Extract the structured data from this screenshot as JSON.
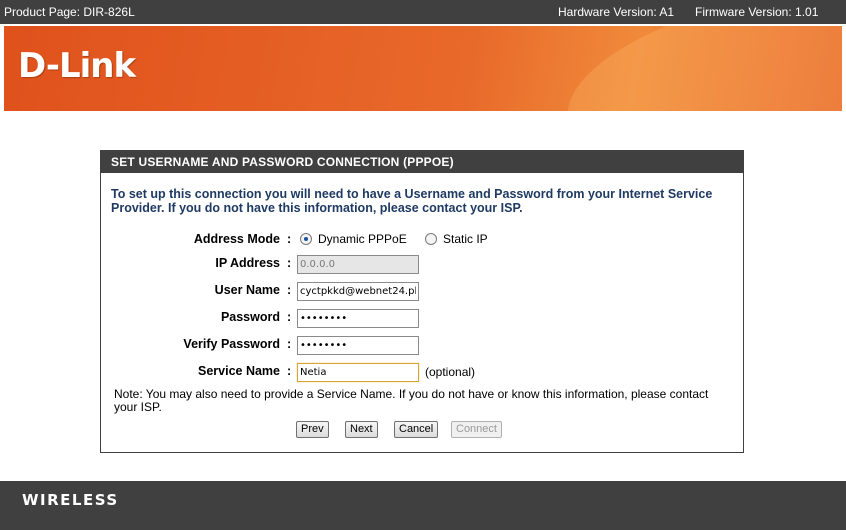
{
  "topbar": {
    "product_page": "Product Page: DIR-826L",
    "hardware_version": "Hardware Version: A1",
    "firmware_version": "Firmware Version: 1.01"
  },
  "banner": {
    "logo_text": "D-Link"
  },
  "panel": {
    "title": "SET USERNAME AND PASSWORD CONNECTION (PPPOE)",
    "intro": "To set up this connection you will need to have a Username and Password from your Internet Service Provider. If you do not have this information, please contact your ISP.",
    "address_mode": {
      "label": "Address Mode",
      "colon": ":",
      "option_dynamic": "Dynamic PPPoE",
      "option_static": "Static IP",
      "selected": "Dynamic PPPoE"
    },
    "ip_address": {
      "label": "IP Address",
      "colon": ":",
      "value": "0.0.0.0"
    },
    "user_name": {
      "label": "User Name",
      "colon": ":",
      "value": "cyctpkkd@webnet24.pl"
    },
    "password": {
      "label": "Password",
      "colon": ":",
      "value": "••••••••"
    },
    "verify_password": {
      "label": "Verify Password",
      "colon": ":",
      "value": "••••••••"
    },
    "service_name": {
      "label": "Service Name",
      "colon": ":",
      "value": "Netia",
      "hint": "(optional)"
    },
    "note": "Note: You may also need to provide a Service Name. If you do not have or know this information, please contact your ISP.",
    "buttons": {
      "prev": "Prev",
      "next": "Next",
      "cancel": "Cancel",
      "connect": "Connect"
    }
  },
  "footer": {
    "brand": "WIRELESS"
  }
}
